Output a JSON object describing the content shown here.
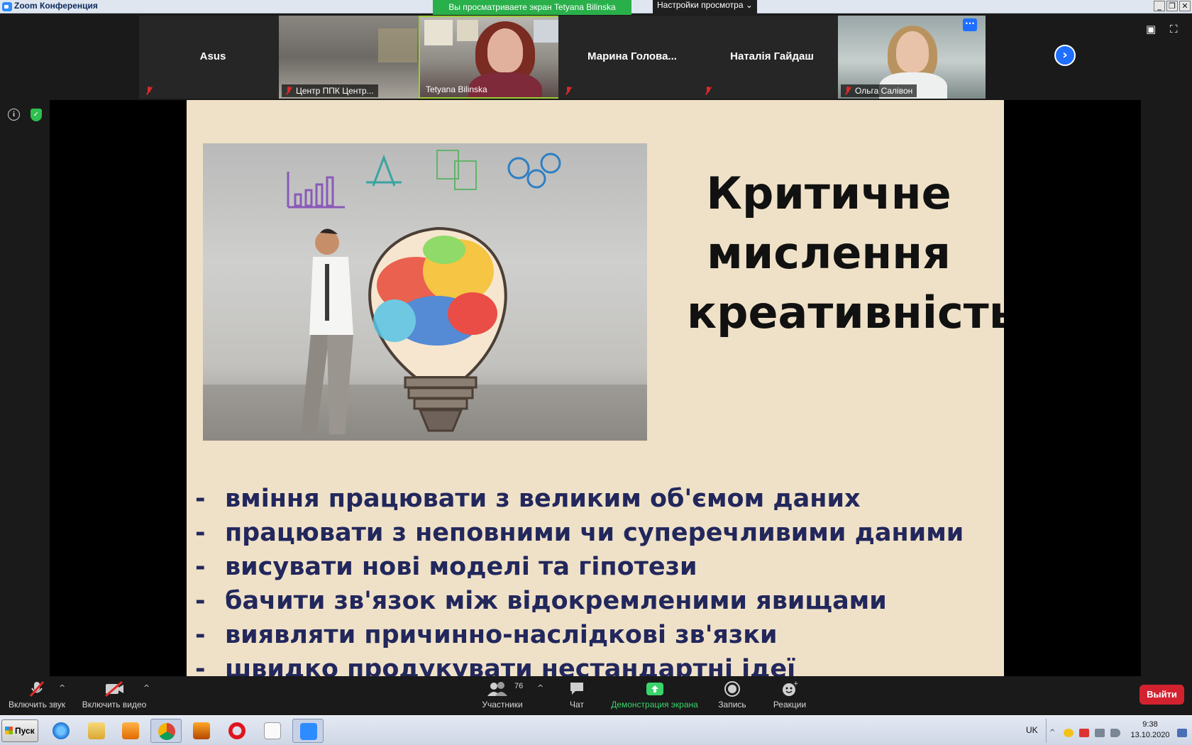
{
  "window": {
    "title": "Zoom Конференция",
    "share_banner": "Вы просматриваете экран Tetyana Bilinska",
    "view_options": "Настройки просмотра ⌄",
    "controls": [
      "_",
      "❐",
      "✕"
    ]
  },
  "participants": [
    {
      "name": "Asus",
      "label": "",
      "video": false
    },
    {
      "name": "",
      "label": "Центр ППК Центр...",
      "video": true
    },
    {
      "name": "",
      "label": "Tetyana Bilinska",
      "video": true,
      "active_speaker": true
    },
    {
      "name": "Марина  Голова...",
      "label": "",
      "video": false
    },
    {
      "name": "Наталія Гайдаш",
      "label": "",
      "video": false
    },
    {
      "name": "",
      "label": "Ольга Салівон",
      "video": true
    }
  ],
  "more_button": "···",
  "next_page_arrow": "›",
  "slide": {
    "title_lines": [
      "Критичне",
      "мислення",
      "креативність"
    ],
    "bullets": [
      "вміння працювати з великим об'ємом даних",
      "працювати з неповними чи суперечливими даними",
      "висувати нові моделі та гіпотези",
      "бачити зв'язок між відокремленими явищами",
      "виявляти причинно-наслідкові зв'язки",
      "швидко продукувати нестандартні ідеї"
    ],
    "bullet_dash": "-"
  },
  "toolbar": {
    "mute_label": "Включить звук",
    "video_label": "Включить видео",
    "participants_label": "Участники",
    "participants_count": "76",
    "chat_label": "Чат",
    "share_label": "Демонстрация экрана",
    "record_label": "Запись",
    "reactions_label": "Реакции",
    "leave_label": "Выйти"
  },
  "taskbar": {
    "start_label": "Пуск",
    "language": "UK",
    "time": "9:38",
    "date": "13.10.2020"
  },
  "colors": {
    "accent_blue": "#1e6fff",
    "share_green": "#29b04b",
    "leave_red": "#d3222f",
    "slide_bg": "#efe1c7",
    "bullet_text": "#22275c"
  }
}
